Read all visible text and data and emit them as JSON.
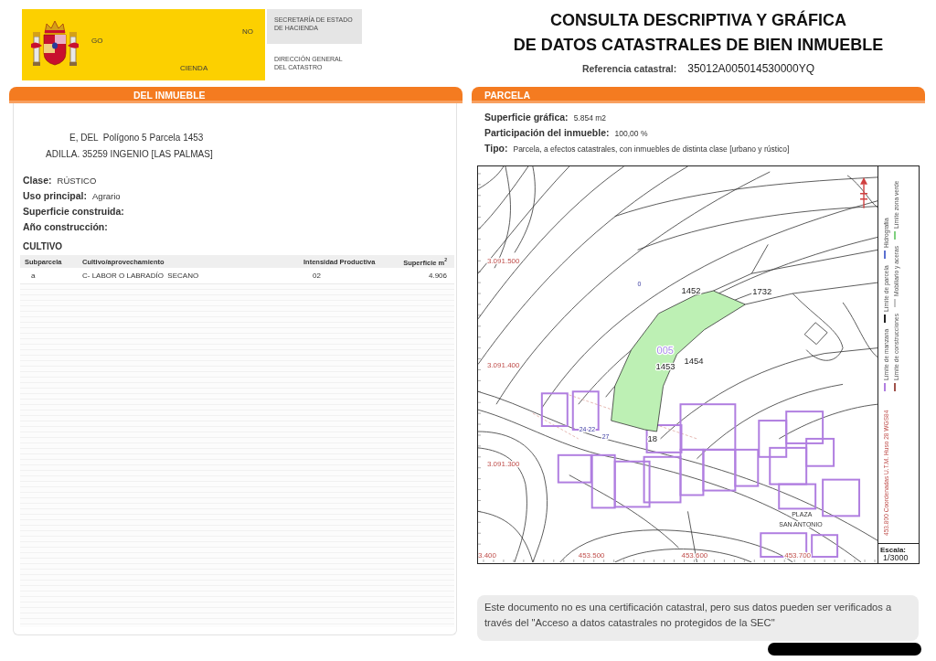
{
  "brand": {
    "logo_text": [
      "GO",
      "NO",
      "CIENDA"
    ],
    "agency": [
      "SECRETARÍA DE ESTADO",
      "DE HACIENDA"
    ],
    "directorate": [
      "DIRECCIÓN GENERAL",
      "DEL CATASTRO"
    ]
  },
  "title": {
    "lines": [
      "CONSULTA DESCRIPTIVA Y GRÁFICA",
      "DE DATOS CATASTRALES DE BIEN INMUEBLE"
    ],
    "reference_label": "Referencia catastral:",
    "reference_value": "35012A005014530000YQ"
  },
  "property": {
    "heading": "DEL INMUEBLE",
    "address_lines": [
      "E, DEL  Polígono 5 Parcela 1453",
      "ADILLA. 35259 INGENIO [LAS PALMAS]"
    ],
    "fields": [
      {
        "label": "Clase:",
        "value": "RÚSTICO"
      },
      {
        "label": "Uso principal:",
        "value": "Agrario"
      },
      {
        "label": "Superficie construida:"
      },
      {
        "label": "Año construcción:"
      }
    ],
    "crops": {
      "title": "CULTIVO",
      "columns": [
        "Subparcela",
        "Cultivo/aprovechamiento",
        "Intensidad Productiva",
        "Superficie m$^{2}$"
      ],
      "rows": [
        [
          "a",
          "C- LABOR O LABRADÍO  SECANO",
          "02",
          "4.906"
        ]
      ]
    }
  },
  "parcel": {
    "heading": "PARCELA",
    "fields": [
      {
        "label": "Superficie gráfica:",
        "value": "5.854 m2"
      },
      {
        "label": "Participación del inmueble:",
        "value": "100,00 %"
      },
      {
        "label": "Tipo:",
        "value": "Parcela, a efectos catastrales, con inmuebles de distinta clase [urbano y rústico]"
      }
    ],
    "map": {
      "northings": [
        "3.091.500",
        "3.091.400",
        "3.091.300"
      ],
      "eastings": [
        "3.400",
        "453.500",
        "453.600",
        "453.700"
      ],
      "labels": [
        {
          "text": "0",
          "kind": "number"
        },
        {
          "text": "1452",
          "kind": "parcel"
        },
        {
          "text": "1732",
          "kind": "parcel"
        },
        {
          "text": "005",
          "kind": "polygon"
        },
        {
          "text": "1453",
          "kind": "parcel"
        },
        {
          "text": "1454",
          "kind": "parcel"
        },
        {
          "text": "18",
          "kind": "parcel"
        },
        {
          "text": "24 22",
          "kind": "number"
        },
        {
          "text": "27",
          "kind": "number"
        },
        {
          "text": "PLAZA",
          "kind": "street"
        },
        {
          "text": "SAN ANTONIO",
          "kind": "street"
        }
      ],
      "legend": [
        {
          "label": "Límite de manzana",
          "color": "#b07ee0"
        },
        {
          "label": "Límite de parcela",
          "color": "#222222"
        },
        {
          "label": "Hidrografía",
          "color": "#5a6fd0"
        },
        {
          "label": "Límite de construcciones",
          "color": "#a0524a"
        },
        {
          "label": "Mobiliario y aceras",
          "color": "#c4c4c4"
        },
        {
          "label": "Límite zona verde",
          "color": "#7fd07f"
        }
      ],
      "projection": "453.800 Coordenadas U.T.M. Huso 28 WGS84",
      "scale_label": "Escala:",
      "scale": "1/3000"
    }
  },
  "note": "Este documento no es una certificación catastral, pero sus datos pueden ser verificados a través del \"Acceso a datos catastrales no protegidos de la SEC\"",
  "redaction_bar": true
}
